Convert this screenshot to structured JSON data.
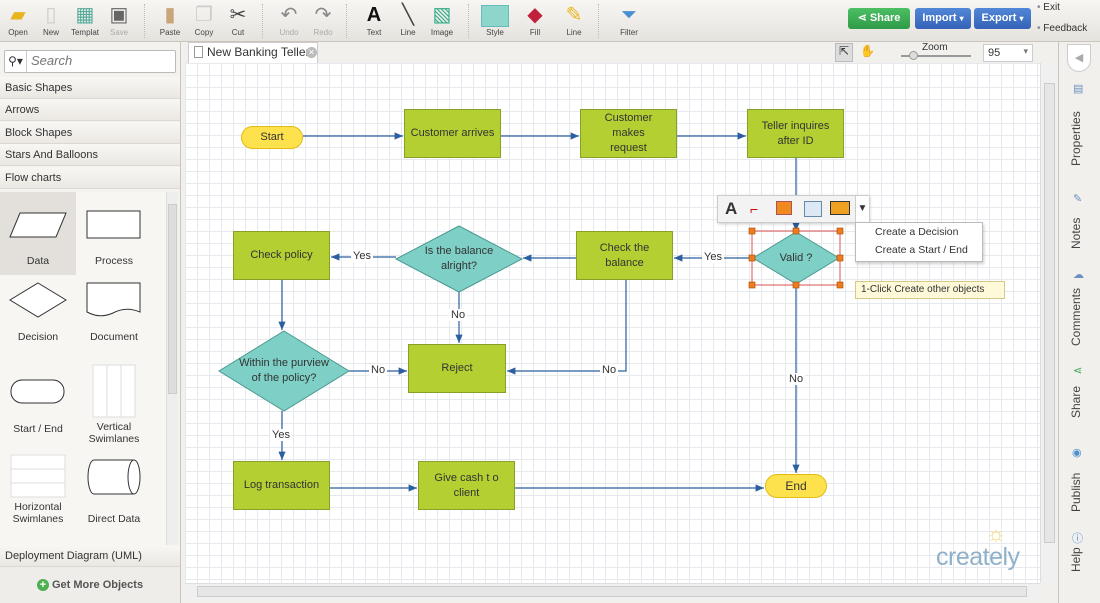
{
  "toolbar": {
    "items": [
      {
        "label": "Open",
        "icon": "folder-icon"
      },
      {
        "label": "New",
        "icon": "new-doc-icon"
      },
      {
        "label": "Templat",
        "icon": "template-icon"
      },
      {
        "label": "Save",
        "icon": "save-icon"
      },
      {
        "label": "Paste",
        "icon": "paste-icon"
      },
      {
        "label": "Copy",
        "icon": "copy-icon"
      },
      {
        "label": "Cut",
        "icon": "scissors-icon"
      },
      {
        "label": "Undo",
        "icon": "undo-icon"
      },
      {
        "label": "Redo",
        "icon": "redo-icon"
      },
      {
        "label": "Text",
        "icon": "text-icon"
      },
      {
        "label": "Line",
        "icon": "line-icon"
      },
      {
        "label": "Image",
        "icon": "image-icon"
      },
      {
        "label": "Style",
        "icon": "style-icon"
      },
      {
        "label": "Fill",
        "icon": "fill-bucket-icon"
      },
      {
        "label": "Line",
        "icon": "pencil-icon"
      },
      {
        "label": "Filter",
        "icon": "filter-icon"
      }
    ],
    "share": "Share",
    "import": "Import",
    "export": "Export",
    "exit": "Exit",
    "feedback": "Feedback"
  },
  "tab": {
    "title": "New Banking Teller"
  },
  "zoom": {
    "label": "Zoom",
    "value": "95"
  },
  "left": {
    "search_placeholder": "Search",
    "categories": [
      "Basic Shapes",
      "Arrows",
      "Block Shapes",
      "Stars And Balloons",
      "Flow charts"
    ],
    "shapes": [
      "Data",
      "Process",
      "Decision",
      "Document",
      "Start / End",
      "Vertical Swimlanes",
      "Horizontal Swimlanes",
      "Direct Data"
    ],
    "bottom_category": "Deployment Diagram (UML)",
    "get_more": "Get More Objects"
  },
  "right": {
    "tabs": [
      "Properties",
      "Notes",
      "Comments",
      "Share",
      "Publish",
      "Help"
    ]
  },
  "diagram": {
    "nodes": {
      "start": "Start",
      "customer_arrives": "Customer arrives",
      "customer_request": "Customer makes request",
      "teller": "Teller inquires after ID",
      "valid": "Valid ?",
      "check_balance": "Check the balance",
      "balance_ok": "Is the balance alright?",
      "check_policy": "Check policy",
      "purview": "Within the purview of the policy?",
      "reject": "Reject",
      "log": "Log transaction",
      "give_cash": "Give cash t o client",
      "end": "End"
    },
    "edge_labels": {
      "yes1": "Yes",
      "yes2": "Yes",
      "yes3": "Yes",
      "no1": "No",
      "no2": "No",
      "no3": "No",
      "no4": "No"
    }
  },
  "context_menu": {
    "items": [
      "Create a Decision",
      "Create a Start / End"
    ]
  },
  "tooltip": "1-Click Create other objects",
  "logo": "creately",
  "colors": {
    "process": "#b3cf32",
    "decision": "#7ecfc5",
    "terminator": "#fde24e",
    "edge": "#2b5fa0",
    "share": "#3aa350",
    "import": "#3b6fc4"
  }
}
